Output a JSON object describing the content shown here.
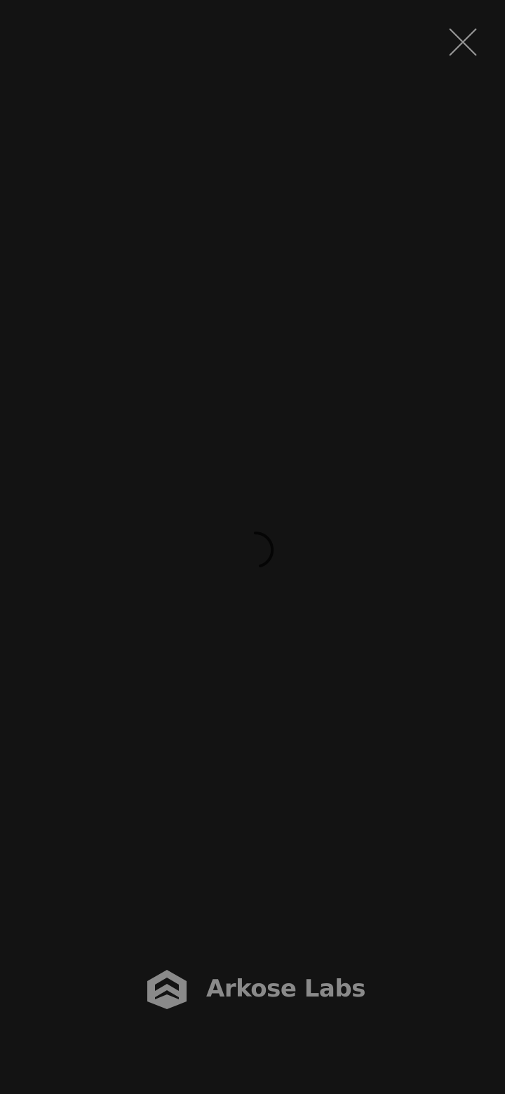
{
  "overlay": {
    "close_icon": "close-icon",
    "loading_icon": "loading-spinner-icon"
  },
  "branding": {
    "name": "Arkose Labs",
    "logo_icon": "arkose-labs-logo-icon"
  },
  "colors": {
    "background": "#131313",
    "close_stroke": "#9a9a9a",
    "brand_gray": "#8a8a8a",
    "spinner": "#050505"
  }
}
